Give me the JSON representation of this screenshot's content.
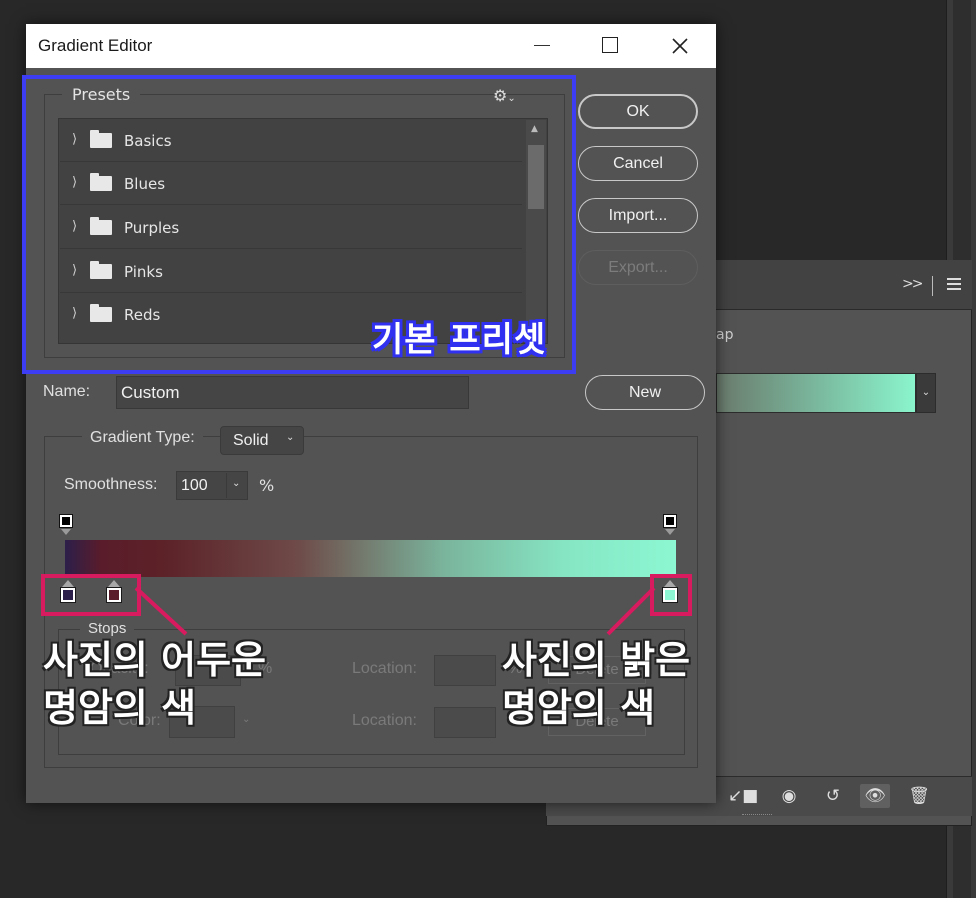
{
  "dialog": {
    "title": "Gradient Editor"
  },
  "presets": {
    "legend": "Presets",
    "gear_icon": "gear-icon",
    "items": [
      {
        "label": "Basics"
      },
      {
        "label": "Blues"
      },
      {
        "label": "Purples"
      },
      {
        "label": "Pinks"
      },
      {
        "label": "Reds"
      }
    ]
  },
  "buttons": {
    "ok": "OK",
    "cancel": "Cancel",
    "import": "Import...",
    "export": "Export...",
    "new": "New"
  },
  "name": {
    "label": "Name:",
    "value": "Custom"
  },
  "gradient_type": {
    "label": "Gradient Type:",
    "selected": "Solid"
  },
  "smoothness": {
    "label": "Smoothness:",
    "value": "100",
    "unit": "%"
  },
  "gradient": {
    "color_stops": [
      "#2c1f4a",
      "#5a1c2a",
      "#8cf7d2"
    ],
    "opacity_stops": [
      "#000000",
      "#000000"
    ]
  },
  "stops": {
    "legend": "Stops",
    "opacity_label": "Opacity:",
    "opacity_unit": "%",
    "color_label": "Color:",
    "location_label": "Location:",
    "location_unit": "%",
    "delete_label": "Delete"
  },
  "background_panel": {
    "map_label": "ap",
    "preview_colors": [
      "#6a7a6c",
      "#8af5cd"
    ]
  },
  "annotations": {
    "presets_caption": "기본 프리셋",
    "dark_caption_line1": "사진의 어두운",
    "dark_caption_line2": "명암의 색",
    "light_caption_line1": "사진의 밝은",
    "light_caption_line2": "명암의 색",
    "box_blue": "#3d3df4",
    "box_red": "#d81b5e"
  }
}
